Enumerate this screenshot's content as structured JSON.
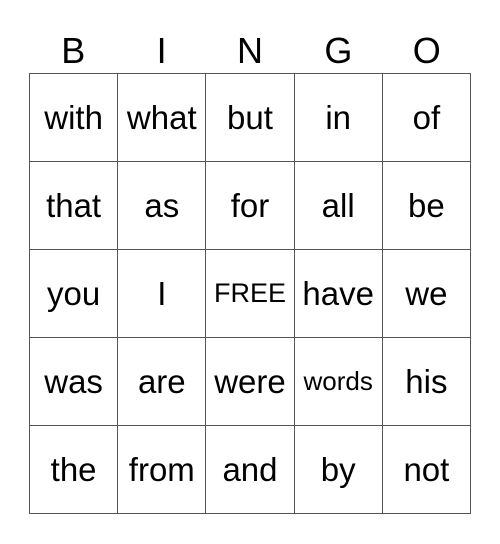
{
  "header": [
    "B",
    "I",
    "N",
    "G",
    "O"
  ],
  "rows": [
    [
      "with",
      "what",
      "but",
      "in",
      "of"
    ],
    [
      "that",
      "as",
      "for",
      "all",
      "be"
    ],
    [
      "you",
      "I",
      "FREE",
      "have",
      "we"
    ],
    [
      "was",
      "are",
      "were",
      "words",
      "his"
    ],
    [
      "the",
      "from",
      "and",
      "by",
      "not"
    ]
  ],
  "free_label": "FREE"
}
